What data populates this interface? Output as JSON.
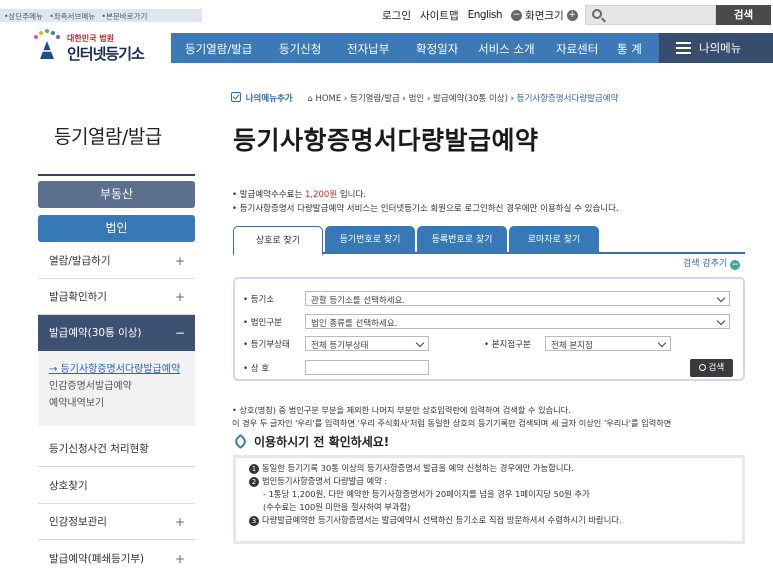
{
  "skip_links": [
    "•상단주메뉴",
    "•좌측서브메뉴",
    "•본문바로가기"
  ],
  "util": {
    "login": "로그인",
    "sitemap": "사이트맵",
    "english": "English",
    "zoom_label": "화면크기",
    "zoom_minus": "−",
    "zoom_plus": "+",
    "search_placeholder": "",
    "search_button": "검색"
  },
  "logo": {
    "sub": "대한민국 법원",
    "main": "인터넷등기소"
  },
  "gnb": [
    "등기열람/발급",
    "등기신청",
    "전자납부",
    "확정일자",
    "서비스 소개",
    "자료센터",
    "통 계"
  ],
  "my_menu": "나의메뉴",
  "sidebar": {
    "title": "등기열람/발급",
    "tabs": [
      "부동산",
      "법인"
    ],
    "items": [
      {
        "label": "열람/발급하기",
        "icon": "+"
      },
      {
        "label": "발급확인하기",
        "icon": "+"
      },
      {
        "label": "발급예약(30통 이상)",
        "icon": "−"
      },
      {
        "label": "등기신청사건 처리현황",
        "icon": ""
      },
      {
        "label": "상호찾기",
        "icon": ""
      },
      {
        "label": "인감정보관리",
        "icon": "+"
      },
      {
        "label": "발급예약(폐쇄등기부)",
        "icon": "+"
      }
    ],
    "sub_items": [
      "→ 등기사항증명서다량발급예약",
      "인감증명서발급예약",
      "예약내역보기"
    ]
  },
  "breadcrumb": {
    "my_menu_add": "나의메뉴추가",
    "path": "HOME › 등기열람/발급 › 법인 › 발급예약(30통 이상) ›",
    "current": "등기사항증명서다량발급예약"
  },
  "page_title": "등기사항증명서다량발급예약",
  "info": {
    "fee_prefix": "• 발급예약수수료는 ",
    "fee_value": "1,200원",
    "fee_suffix": " 입니다.",
    "notice": "• 등기사항증명서 다량발급예약 서비스는 인터넷등기소 회원으로 로그인하신 경우에만 이용하실 수 있습니다."
  },
  "tabs": [
    "상호로 찾기",
    "등기번호로 찾기",
    "등록번호로 찾기",
    "로마자로 찾기"
  ],
  "toggle": {
    "label": "검색 감추기",
    "icon": "−"
  },
  "form": {
    "registry_label": "• 등기소",
    "registry_value": "관할 등기소를 선택하세요.",
    "corp_type_label": "• 법인구분",
    "corp_type_value": "법인 종류를 선택하세요.",
    "status_label": "• 등기부상태",
    "status_value": "전체 등기부상태",
    "branch_label": "• 본지점구분",
    "branch_value": "전체 본지점",
    "name_label": "• 상 호",
    "name_value": "",
    "search_button": "검색"
  },
  "note": [
    "• 상호(명칭) 중 법인구분 부분을 제외한 나머지 부분만 상호입력란에 입력하여 검색할 수 있습니다.",
    "  이 경우 두 글자인 '우리'를 입력하면 '우리 주식회사'처럼 동일한 상호의 등기기록만 검색되며 세 글자 이상인 '우리나'를 입력하면"
  ],
  "check_title": "이용하시기 전 확인하세요!",
  "check_items": [
    {
      "num": "1",
      "text": "동일한 등기기록 30통 이상의 등기사항증명서 발급을 예약 신청하는 경우에만 가능합니다."
    },
    {
      "num": "2",
      "text": "법인등기사항증명서 다량발급 예약 :"
    },
    {
      "num": "",
      "text": "  - 1통당 1,200원, 다만 예약한 등기사항증명서가 20페이지를 넘을 경우 1페이지당 50원 추가"
    },
    {
      "num": "",
      "text": "  (수수료는 100원 미만을 절사하여 부과함)"
    },
    {
      "num": "3",
      "text": "다량발급예약한 등기사항증명서는 발급예약시 선택하신 등기소로 직접 방문하셔서 수령하시기 바랍니다."
    }
  ]
}
